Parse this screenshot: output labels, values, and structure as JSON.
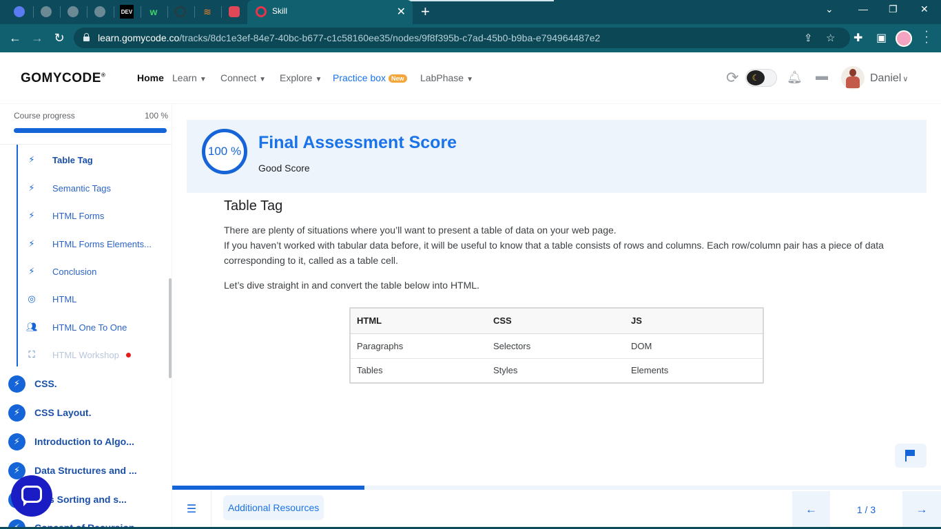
{
  "browser": {
    "pinned_tabs": [
      {
        "icon": "app-icon"
      },
      {
        "icon": "globe-icon"
      },
      {
        "icon": "globe-icon"
      },
      {
        "icon": "globe-icon"
      },
      {
        "icon": "dev-logo-icon",
        "text": "DEV"
      },
      {
        "icon": "w-logo-icon",
        "text": "w"
      },
      {
        "icon": "circle-icon"
      },
      {
        "icon": "stackoverflow-icon"
      },
      {
        "icon": "hexagon-icon"
      }
    ],
    "active_tab": {
      "title": "Skill",
      "icon": "gomycode-icon"
    },
    "url_host": "learn.gomycode.co",
    "url_path": "/tracks/8dc1e3ef-84e7-40bc-b677-c1c58160ee35/nodes/9f8f395b-c7ad-45b0-b9ba-e794964487e2"
  },
  "header": {
    "logo": "GOMYCODE",
    "logo_mark": "®",
    "nav": {
      "home": "Home",
      "learn": "Learn",
      "connect": "Connect",
      "explore": "Explore",
      "practice": "Practice box",
      "practice_badge": "New",
      "labphase": "LabPhase"
    },
    "user_name": "Daniel",
    "theme": "dark-toggle"
  },
  "sidebar": {
    "progress_label": "Course progress",
    "progress_text": "100 %",
    "progress_value": 1.0,
    "lessons": [
      {
        "label": "Table Tag",
        "icon": "bolt-icon",
        "active": true
      },
      {
        "label": "Semantic Tags",
        "icon": "bolt-icon"
      },
      {
        "label": "HTML Forms",
        "icon": "bolt-icon"
      },
      {
        "label": "HTML Forms Elements...",
        "icon": "bolt-icon"
      },
      {
        "label": "Conclusion",
        "icon": "bolt-icon"
      },
      {
        "label": "HTML",
        "icon": "target-icon"
      },
      {
        "label": "HTML One To One",
        "icon": "people-icon"
      },
      {
        "label": "HTML Workshop",
        "icon": "workshop-icon",
        "disabled": true
      }
    ],
    "modules": [
      {
        "label": "CSS."
      },
      {
        "label": "CSS Layout."
      },
      {
        "label": "Introduction to Algo..."
      },
      {
        "label": "Data Structures and ..."
      },
      {
        "label": "ious Sorting and s..."
      },
      {
        "label": "Concept of Recursion"
      }
    ]
  },
  "main": {
    "score": {
      "value": "100 %",
      "title": "Final Assessment Score",
      "subtitle": "Good Score"
    },
    "lesson_title": "Table Tag",
    "paragraphs": [
      "There are plenty of situations where you’ll want to present a table of data on your web page.",
      "If you haven’t worked with tabular data before, it will be useful to know that a table consists of rows and columns. Each row/column pair has a piece of data corresponding to it, called as a table cell.",
      "Let’s dive straight in and convert the table below into HTML."
    ],
    "table": {
      "headers": [
        "HTML",
        "CSS",
        "JS"
      ],
      "rows": [
        [
          "Paragraphs",
          "Selectors",
          "DOM"
        ],
        [
          "Tables",
          "Styles",
          "Elements"
        ]
      ]
    }
  },
  "footer": {
    "lesson_progress": 0.25,
    "resources_label": "Additional Resources",
    "page_indicator": "1 / 3"
  },
  "colors": {
    "brand_blue": "#1565d8",
    "browser_teal": "#11606f",
    "banner_bg": "#eef4fc",
    "workshop_dot": "#e11d1d"
  }
}
